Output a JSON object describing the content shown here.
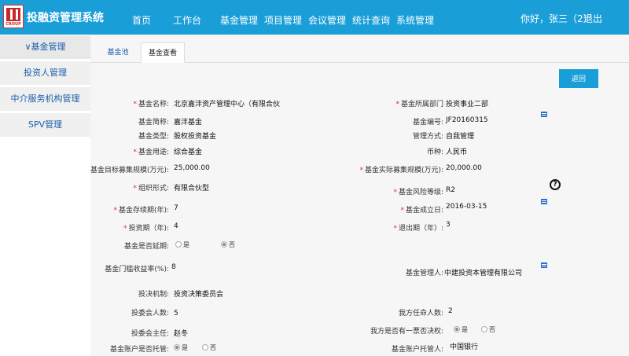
{
  "header": {
    "app_title": "投融资管理系统",
    "logo_sub": "CROUP",
    "nav": [
      "首页",
      "工作台",
      "基金管理",
      "项目管理",
      "会议管理",
      "统计查询",
      "系统管理"
    ],
    "user_info": "你好，张三（2）",
    "logout": "退出"
  },
  "sidebar": {
    "items": [
      "∨基金管理",
      "投资人管理",
      "中介服务机构管理",
      "SPV管理"
    ]
  },
  "tabs": [
    "基金池",
    "基金查看"
  ],
  "back_button": "返回",
  "form": {
    "fund_name_label": "基金名称:",
    "fund_name": "北京嘉沣资产管理中心（有限合伙",
    "dept_label": "基金所属部门",
    "dept": "投资事业二部",
    "short_name_label": "基金简称:",
    "short_name": "嘉沣基金",
    "code_label": "基金编号:",
    "code": "JF20160315",
    "type_label": "基金类型:",
    "type": "股权投资基金",
    "manage_mode_label": "管理方式:",
    "manage_mode": "自我管理",
    "usage_label": "基金用途:",
    "usage": "综合基金",
    "currency_label": "币种:",
    "currency": "人民币",
    "target_scale_label": "基金目标募集规模(万元):",
    "target_scale": "25,000.00",
    "actual_scale_label": "基金实际募集规模(万元):",
    "actual_scale": "20,000.00",
    "org_form_label": "组织形式:",
    "org_form": "有限合伙型",
    "risk_label": "基金风险等级:",
    "risk": "R2",
    "duration_label": "基金存续期(年):",
    "duration": "7",
    "found_date_label": "基金成立日:",
    "found_date": "2016-03-15",
    "invest_period_label": "投资期（年):",
    "invest_period": "4",
    "exit_period_label": "退出期（年）:",
    "exit_period": "3",
    "extend_label": "基金是否延期:",
    "extend_yes": "是",
    "extend_no": "否",
    "threshold_label": "基金门槛收益率(%):",
    "threshold": "8",
    "manager_label": "基金管理人:",
    "manager": "中建投资本管理有限公司",
    "decision_label": "投决机制:",
    "decision": "投资决策委员会",
    "committee_count_label": "投委会人数:",
    "committee_count": "5",
    "our_appoint_label": "我方任命人数:",
    "our_appoint": "2",
    "committee_chair_label": "投委会主任:",
    "committee_chair": "赵冬",
    "veto_label": "我方是否有一票否决权:",
    "veto_yes": "是",
    "veto_no": "否",
    "custody_label": "基金账户是否托管:",
    "custody_yes": "是",
    "custody_no": "否",
    "custodian_label": "基金账户托管人:",
    "custodian": "中国银行"
  }
}
